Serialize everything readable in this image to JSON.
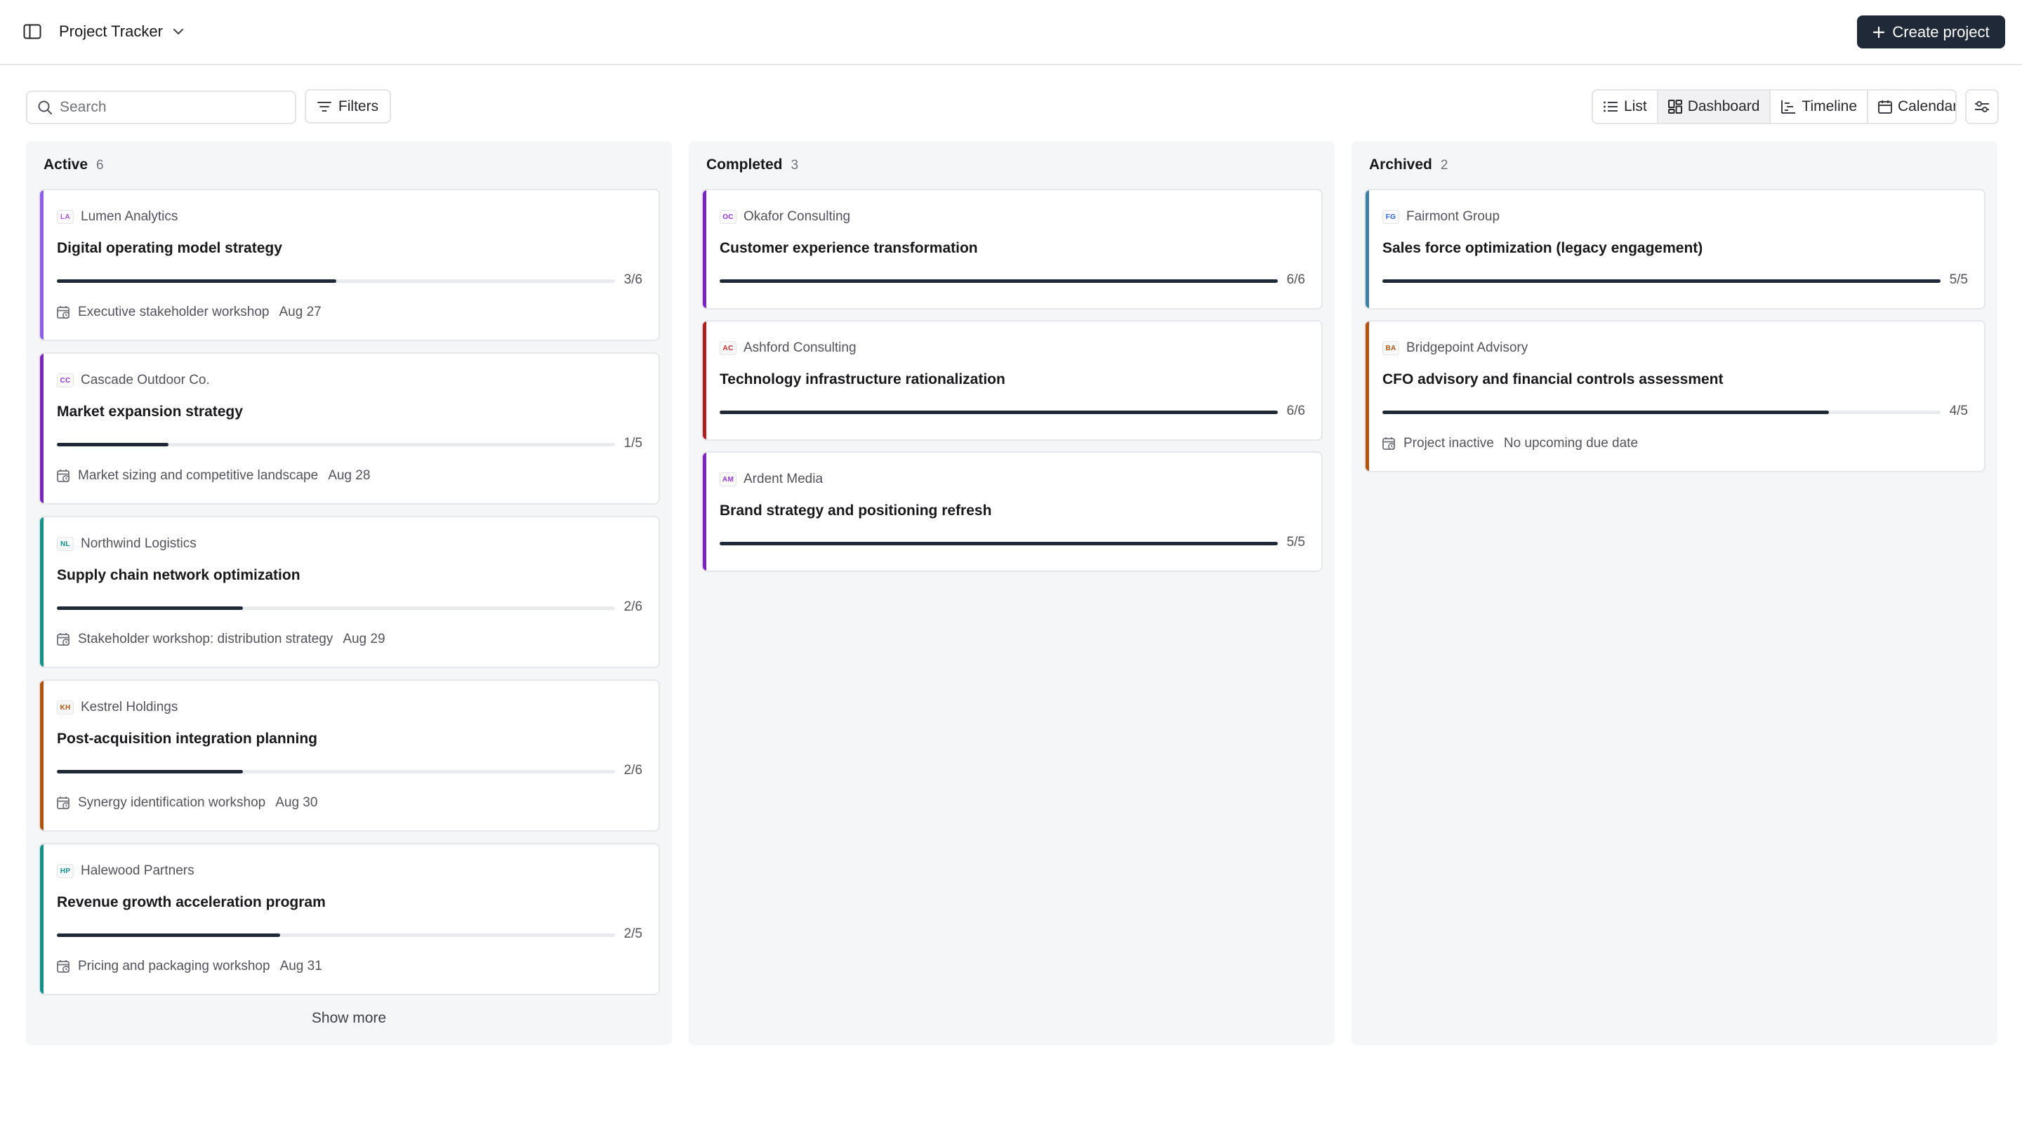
{
  "header": {
    "project_name": "Project Tracker",
    "create_label": "Create project"
  },
  "toolbar": {
    "search_placeholder": "Search",
    "filters_label": "Filters",
    "views": [
      {
        "label": "List",
        "icon": "list-icon",
        "active": false
      },
      {
        "label": "Dashboard",
        "icon": "dashboard-icon",
        "active": true
      },
      {
        "label": "Timeline",
        "icon": "timeline-icon",
        "active": false
      },
      {
        "label": "Calendar",
        "icon": "calendar-icon",
        "active": false
      }
    ]
  },
  "columns": [
    {
      "title": "Active",
      "count": "6",
      "show_more": "Show more",
      "cards": [
        {
          "initials": "LA",
          "client": "Lumen Analytics",
          "title": "Digital operating model strategy",
          "progress": 0.5,
          "ratio": "3/6",
          "meta_label": "Executive stakeholder workshop",
          "meta_date": "Aug 27",
          "accent": "#8b5cf6",
          "badge_color": "#a855f7"
        },
        {
          "initials": "CC",
          "client": "Cascade Outdoor Co.",
          "title": "Market expansion strategy",
          "progress": 0.2,
          "ratio": "1/5",
          "meta_label": "Market sizing and competitive landscape",
          "meta_date": "Aug 28",
          "accent": "#7e22ce",
          "badge_color": "#9333ea"
        },
        {
          "initials": "NL",
          "client": "Northwind Logistics",
          "title": "Supply chain network optimization",
          "progress": 0.333,
          "ratio": "2/6",
          "meta_label": "Stakeholder workshop: distribution strategy",
          "meta_date": "Aug 29",
          "accent": "#0d9488",
          "badge_color": "#0d9488"
        },
        {
          "initials": "KH",
          "client": "Kestrel Holdings",
          "title": "Post-acquisition integration planning",
          "progress": 0.333,
          "ratio": "2/6",
          "meta_label": "Synergy identification workshop",
          "meta_date": "Aug 30",
          "accent": "#b45309",
          "badge_color": "#b45309"
        },
        {
          "initials": "HP",
          "client": "Halewood Partners",
          "title": "Revenue growth acceleration program",
          "progress": 0.4,
          "ratio": "2/5",
          "meta_label": "Pricing and packaging workshop",
          "meta_date": "Aug 31",
          "accent": "#0d9488",
          "badge_color": "#0d9488"
        }
      ]
    },
    {
      "title": "Completed",
      "count": "3",
      "cards": [
        {
          "initials": "OC",
          "client": "Okafor Consulting",
          "title": "Customer experience transformation",
          "progress": 1.0,
          "ratio": "6/6",
          "accent": "#7e22ce",
          "badge_color": "#9333ea"
        },
        {
          "initials": "AC",
          "client": "Ashford Consulting",
          "title": "Technology infrastructure rationalization",
          "progress": 1.0,
          "ratio": "6/6",
          "accent": "#b91c1c",
          "badge_color": "#dc2626"
        },
        {
          "initials": "AM",
          "client": "Ardent Media",
          "title": "Brand strategy and positioning refresh",
          "progress": 1.0,
          "ratio": "5/5",
          "accent": "#7e22ce",
          "badge_color": "#9333ea"
        }
      ]
    },
    {
      "title": "Archived",
      "count": "2",
      "cards": [
        {
          "initials": "FG",
          "client": "Fairmont Group",
          "title": "Sales force optimization (legacy engagement)",
          "progress": 1.0,
          "ratio": "5/5",
          "accent": "#3b82a6",
          "badge_color": "#2563eb"
        },
        {
          "initials": "BA",
          "client": "Bridgepoint Advisory",
          "title": "CFO advisory and financial controls assessment",
          "progress": 0.8,
          "ratio": "4/5",
          "meta_label": "Project inactive",
          "meta_date": "No upcoming due date",
          "accent": "#b45309",
          "badge_color": "#b45309"
        }
      ]
    }
  ]
}
